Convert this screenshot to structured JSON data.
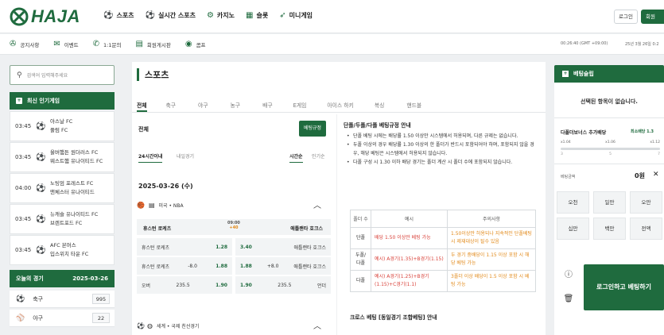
{
  "brand": {
    "logo_text": "HAJA"
  },
  "nav": [
    {
      "label": "스포츠",
      "icon": "soccer-ball-icon"
    },
    {
      "label": "실시간 스포츠",
      "icon": "soccer-ball-icon"
    },
    {
      "label": "카지노",
      "icon": "chip-icon"
    },
    {
      "label": "슬롯",
      "icon": "slot-icon"
    },
    {
      "label": "미니게임",
      "icon": "rocket-icon"
    }
  ],
  "auth": {
    "login": "로그인",
    "join": "회원"
  },
  "subnav": [
    {
      "label": "공지사항",
      "icon": "megaphone-icon"
    },
    {
      "label": "이벤트",
      "icon": "gift-icon"
    },
    {
      "label": "1:1문의",
      "icon": "chat-icon"
    },
    {
      "label": "회원게시판",
      "icon": "board-icon"
    },
    {
      "label": "콤프",
      "icon": "coin-icon"
    }
  ],
  "clock": {
    "time": "00:26:40 (GMT +09:00)",
    "date": "25년 3월 26일 0:2"
  },
  "left": {
    "search_placeholder": "검색어 입력해주세요",
    "popular_title": "최신 인기게임",
    "popular": [
      {
        "time": "03:45",
        "home": "아스날 FC",
        "away": "풀럼 FC"
      },
      {
        "time": "03:45",
        "home": "울버햄튼 원더러스 FC",
        "away": "웨스트햄 유나이티드 FC"
      },
      {
        "time": "04:00",
        "home": "노팅엄 포레스트 FC",
        "away": "맨체스터 유나이티드"
      },
      {
        "time": "03:45",
        "home": "뉴캐슬 유나이티드 FC",
        "away": "브렌트포드 FC"
      },
      {
        "time": "03:45",
        "home": "AFC 본머스",
        "away": "입스위치 타운 FC"
      }
    ],
    "today_title": "오늘의 경기",
    "today_date": "2025-03-26",
    "today": [
      {
        "sport": "축구",
        "count": "995",
        "icon": "soccer-ball-icon"
      },
      {
        "sport": "야구",
        "count": "22",
        "icon": "baseball-icon"
      }
    ]
  },
  "main": {
    "title": "스포츠",
    "tabs": [
      "전체",
      "축구",
      "야구",
      "농구",
      "배구",
      "E게임",
      "아이스 하키",
      "복싱",
      "핸드볼"
    ],
    "all_label": "전체",
    "bet_rule_button": "베팅규정",
    "filter_left": [
      "24시간이내",
      "내일경기"
    ],
    "filter_right": [
      "시간순",
      "인기순"
    ],
    "date": "2025-03-26 (수)",
    "league": "미국 • NBA",
    "home_team": "휴스턴 로케츠",
    "away_team": "애틀랜타 호크스",
    "match_time": "09:00",
    "match_more": "+40",
    "odds": [
      {
        "left": "휴스턴 로케츠",
        "lv": "1.28",
        "mv": "3.40",
        "right": "애틀랜타 호크스"
      },
      {
        "left": "휴스턴 로케츠",
        "lmid": "-8.0",
        "lv": "1.88",
        "mv": "1.88",
        "rmid": "+8.0",
        "right": "애틀랜타 호크스"
      },
      {
        "left": "오버",
        "lmid": "235.5",
        "lv": "1.90",
        "mv": "1.90",
        "rmid": "235.5",
        "right": "언더"
      }
    ],
    "league2": "세계 • 국제 친선경기",
    "rules": {
      "title": "단폴/두폴/다폴 베팅규정 안내",
      "items": [
        "단폴 베팅 시에는 배당률 1.50 이상만 시스템에서 허용되며, 다른 규제는 없습니다.",
        "두폴 이상의 경우 배당률 1.30 이상의 한 폴더가 반드시 포함되어야 하며, 포함되지 않을 경우, 해당 베팅은 시스템에서 허용되지 않습니다.",
        "다폴 구성 시 1.30 이하 배당 경기는 폴더 계산 시 폴더 수에 포함되지 않습니다."
      ],
      "headers": [
        "폴더 수",
        "예시",
        "주의사항"
      ],
      "rows": [
        {
          "kind": "단폴",
          "example": "배당 1.50 이상만 베팅 가능",
          "note": "1.50이상만 허용되나 지속적인 단폴베팅시 제재대상이 될수 있음"
        },
        {
          "kind": "두폴/다폴",
          "example": "예시) A경기(1.35)+B경기(1.15)",
          "note": "두 경기 중배당이 1.15 이상 포함 시 해당 베팅 가능"
        },
        {
          "kind": "다폴",
          "example": "예시) A경기(1.25)+B경기(1.15)+C경기(1.1)",
          "note": "3폴더 이상 배당이 1.5 이상 포함 시 베팅 가능"
        }
      ],
      "title2": "크로스 베팅 [동일경기 조합베팅] 안내"
    }
  },
  "slip": {
    "title": "베팅슬립",
    "empty": "선택된 항목이 없습니다.",
    "bonus_label": "다폴더보너스 추가배당",
    "bonus_min": "최소배당 1.3",
    "bonus_values": [
      "x1.04",
      "x1.06",
      "x1.12"
    ],
    "bonus_ticks": [
      "3",
      "5",
      "7"
    ],
    "amount_label": "베팅금액",
    "amount_value": "0원",
    "chips": [
      "오천",
      "일만",
      "오만",
      "십만",
      "백만",
      "전액"
    ],
    "go_button": "로그인하고 베팅하기"
  }
}
